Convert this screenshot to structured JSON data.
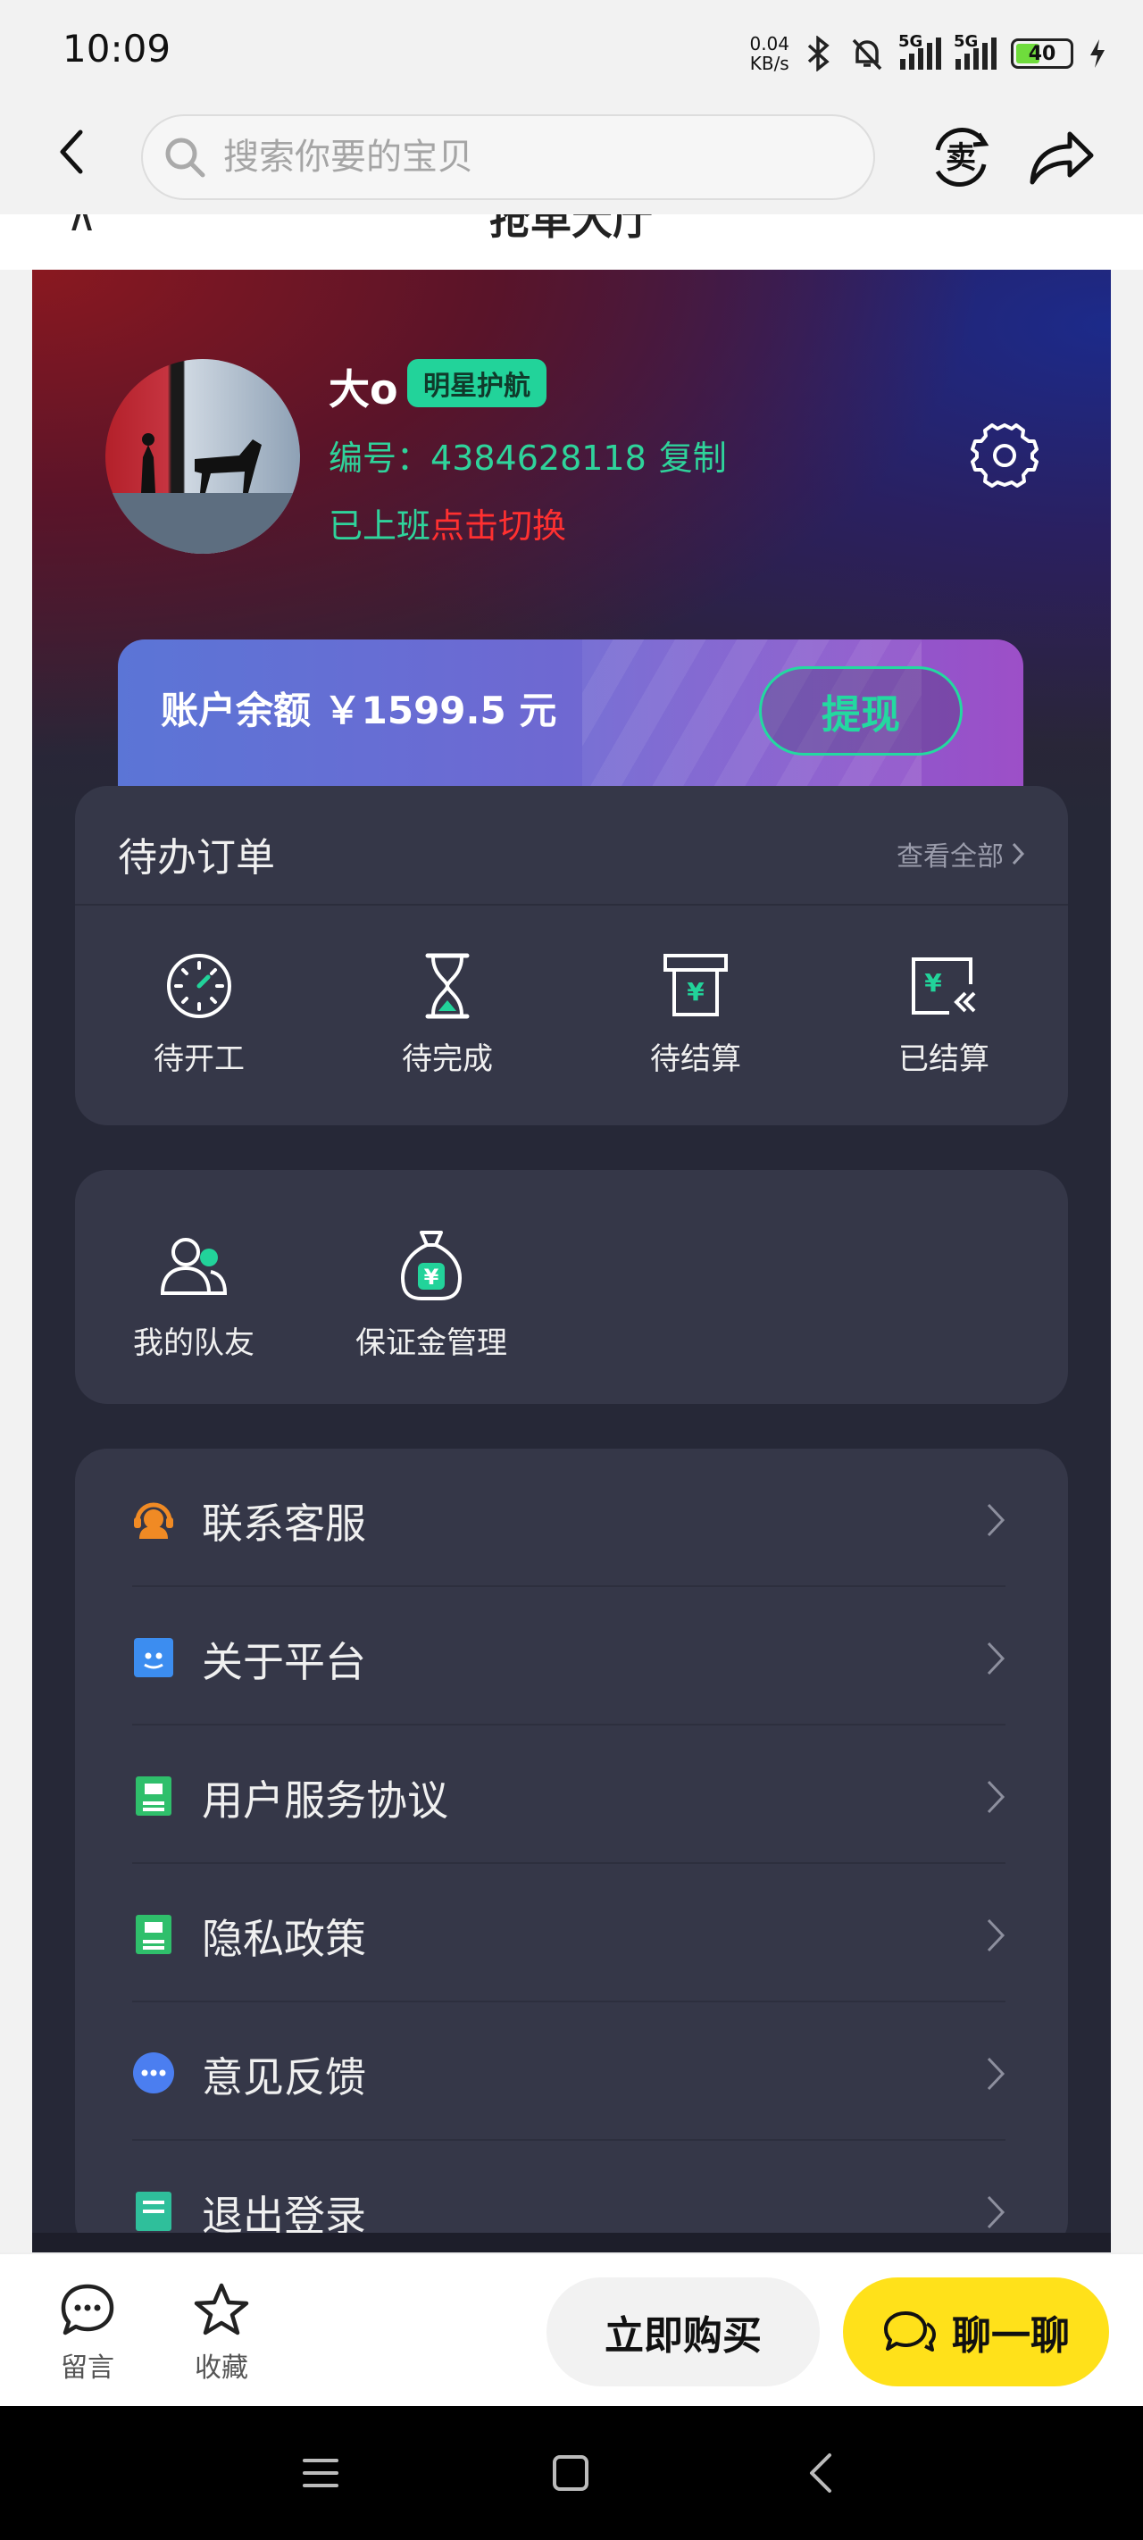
{
  "status_bar": {
    "time": "10:09",
    "net_speed_value": "0.04",
    "net_speed_unit": "KB/s",
    "sim1": "5G",
    "sim2": "5G",
    "battery": "40"
  },
  "search": {
    "placeholder": "搜索你要的宝贝",
    "sell_glyph": "卖"
  },
  "web": {
    "title": "抢单大厅"
  },
  "profile": {
    "name": "大o",
    "badge": "明星护航",
    "id_label": "编号：",
    "id_value": "4384628118",
    "copy_label": "复制",
    "status": "已上班",
    "switch_label": "点击切换"
  },
  "balance": {
    "text": "账户余额 ￥1599.5 元",
    "withdraw_label": "提现"
  },
  "orders": {
    "title": "待办订单",
    "view_all": "查看全部",
    "items": [
      {
        "label": "待开工",
        "icon": "clock-icon"
      },
      {
        "label": "待完成",
        "icon": "hourglass-icon"
      },
      {
        "label": "待结算",
        "icon": "pos-terminal-icon"
      },
      {
        "label": "已结算",
        "icon": "settled-yen-icon"
      }
    ]
  },
  "tools": {
    "items": [
      {
        "label": "我的队友",
        "icon": "teammates-icon"
      },
      {
        "label": "保证金管理",
        "icon": "money-bag-icon"
      }
    ]
  },
  "menu": {
    "items": [
      {
        "label": "联系客服",
        "icon": "headset-icon"
      },
      {
        "label": "关于平台",
        "icon": "platform-icon"
      },
      {
        "label": "用户服务协议",
        "icon": "agreement-icon"
      },
      {
        "label": "隐私政策",
        "icon": "privacy-icon"
      },
      {
        "label": "意见反馈",
        "icon": "feedback-icon"
      },
      {
        "label": "退出登录",
        "icon": "logout-icon"
      }
    ]
  },
  "bottom_bar": {
    "message_label": "留言",
    "favorite_label": "收藏",
    "buy_label": "立即购买",
    "chat_label": "聊一聊"
  },
  "colors": {
    "accent_green": "#22d39a",
    "switch_red": "#ff3030",
    "chat_yellow": "#ffe11a",
    "card_bg": "#353748",
    "frame_bg": "#262837"
  }
}
